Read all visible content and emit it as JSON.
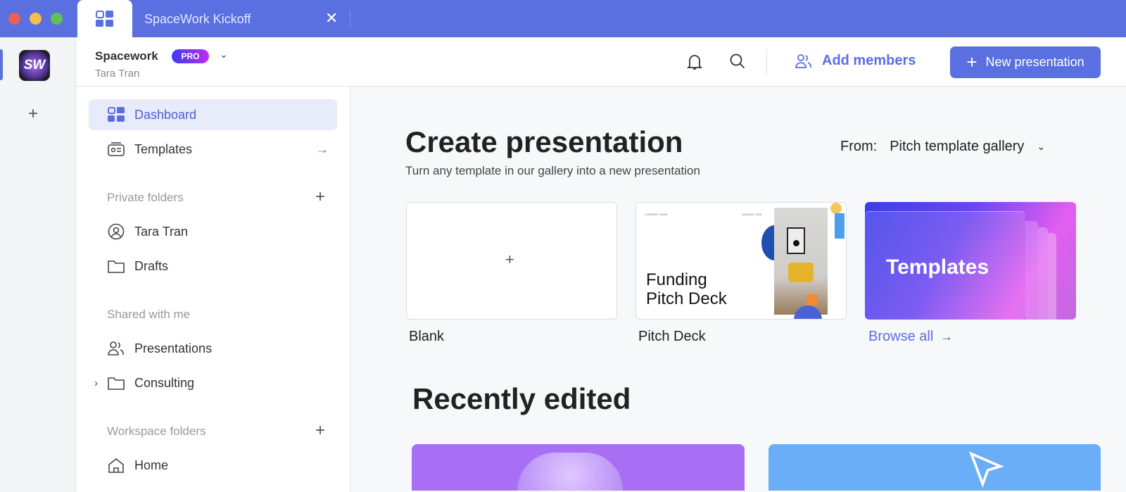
{
  "window": {
    "tab_title": "SpaceWork Kickoff",
    "traffic_colors": [
      "#ec5f57",
      "#f4bd4f",
      "#5fc453"
    ]
  },
  "rail": {
    "logo_text": "SW",
    "add_label": "+"
  },
  "header": {
    "workspace": "Spacework",
    "badge": "PRO",
    "user": "Tara Tran",
    "add_members": "Add members",
    "new_presentation": "New presentation",
    "plus": "+"
  },
  "sidebar": {
    "dashboard": "Dashboard",
    "templates": "Templates",
    "private_folders": "Private folders",
    "tara": "Tara Tran",
    "drafts": "Drafts",
    "shared_with_me": "Shared with me",
    "presentations": "Presentations",
    "consulting": "Consulting",
    "workspace_folders": "Workspace folders",
    "home": "Home"
  },
  "main": {
    "title": "Create presentation",
    "subtitle": "Turn any template in our gallery into a new presentation",
    "from_label": "From:",
    "from_value": "Pitch template gallery",
    "cards": {
      "blank": "Blank",
      "pitch": "Pitch Deck",
      "pitch_thumb_title": "Funding Pitch Deck",
      "pitch_company": "COMPANY NAME",
      "pitch_date": "JANUARY 2026",
      "templates_thumb": "Templates",
      "browse": "Browse all"
    },
    "recent_title": "Recently edited"
  },
  "colors": {
    "accent": "#5a6fe0"
  }
}
